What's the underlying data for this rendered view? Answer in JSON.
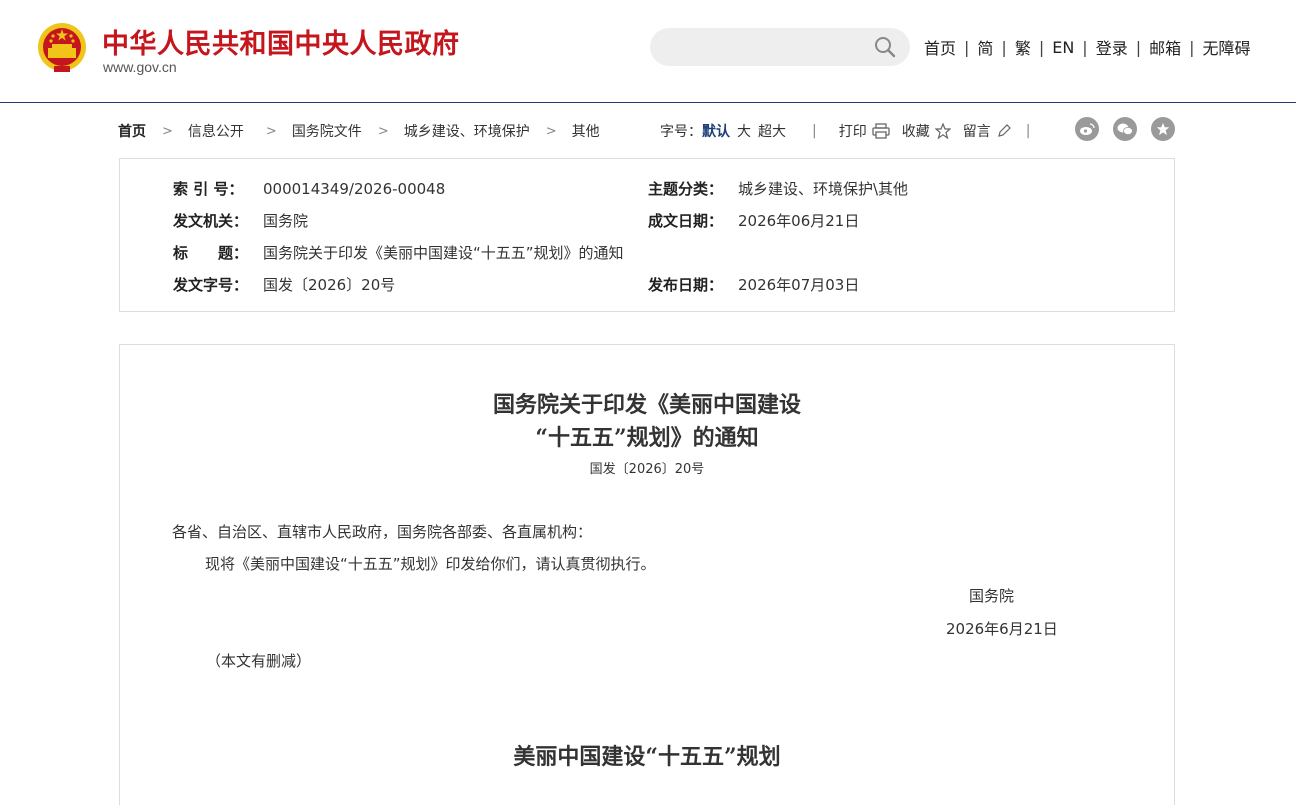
{
  "header": {
    "site_title": "中华人民共和国中央人民政府",
    "site_url": "www.gov.cn",
    "emblem": "national-emblem",
    "search_placeholder": "",
    "nav": [
      "首页",
      "简",
      "繁",
      "EN",
      "登录",
      "邮箱",
      "无障碍"
    ],
    "nav_separator": "|"
  },
  "breadcrumb": {
    "items": [
      "首页",
      "信息公开",
      "国务院文件",
      "城乡建设、环境保护",
      "其他"
    ],
    "separator": ">"
  },
  "tools": {
    "font_size_label": "字号：",
    "font_default": "默认",
    "font_large": "大",
    "font_xlarge": "超大",
    "divider": "|",
    "print": "打印",
    "favorite": "收藏",
    "comment": "留言",
    "share_icons": [
      "weibo-icon",
      "wechat-icon",
      "star-icon"
    ]
  },
  "info": {
    "index_label": "索 引 号：",
    "index_value": "000014349/2026-00048",
    "category_label": "主题分类：",
    "category_value": "城乡建设、环境保护\\其他",
    "issuer_label": "发文机关：",
    "issuer_value": "国务院",
    "date_written_label": "成文日期：",
    "date_written_value": "2026年06月21日",
    "title_label": "标　　题：",
    "title_value": "国务院关于印发《美丽中国建设“十五五”规划》的通知",
    "doc_no_label": "发文字号：",
    "doc_no_value": "国发〔2026〕20号",
    "publish_label": "发布日期：",
    "publish_value": "2026年07月03日"
  },
  "article": {
    "title_line1": "国务院关于印发《美丽中国建设",
    "title_line2": "“十五五”规划》的通知",
    "doc_no": "国发〔2026〕20号",
    "salutation": "各省、自治区、直辖市人民政府，国务院各部委、各直属机构：",
    "body": "现将《美丽中国建设“十五五”规划》印发给你们，请认真贯彻执行。",
    "signature": "国务院",
    "sign_date": "2026年6月21日",
    "note": "（本文有删减）",
    "subtitle": "美丽中国建设“十五五”规划"
  },
  "colors": {
    "brand_red": "#c4161c",
    "nav_blue": "#1c3f78",
    "emblem_gold": "#f0c419"
  }
}
